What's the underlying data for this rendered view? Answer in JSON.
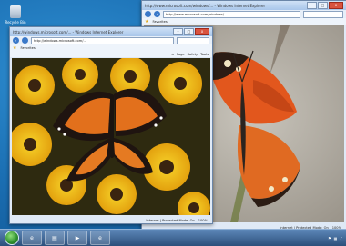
{
  "desktop": {
    "recycle_bin_label": "Recycle Bin"
  },
  "back_window": {
    "title": "http://www.microsoft.com/windows/... - Windows Internet Explorer",
    "url": "http://www.microsoft.com/windows/...",
    "favorites_label": "Favorites",
    "status_zone": "Internet | Protected Mode: On",
    "zoom": "100%"
  },
  "front_window": {
    "title": "http://windows.microsoft.com/... - Windows Internet Explorer",
    "url": "http://windows.microsoft.com/...",
    "favorites_label": "Favorites",
    "cmd_items": [
      "Page",
      "Safety",
      "Tools"
    ],
    "status_zone": "Internet | Protected Mode: On",
    "zoom": "100%"
  },
  "taskbar": {
    "buttons": [
      "Internet Explorer",
      "Windows Explorer",
      "Media Player",
      "Internet Explorer"
    ],
    "tray_icons": [
      "flag-icon",
      "network-icon",
      "volume-icon"
    ]
  },
  "colors": {
    "desktop": "#1b6fb3",
    "titlebar": "#a9c6ea",
    "close_button": "#d9533f"
  }
}
